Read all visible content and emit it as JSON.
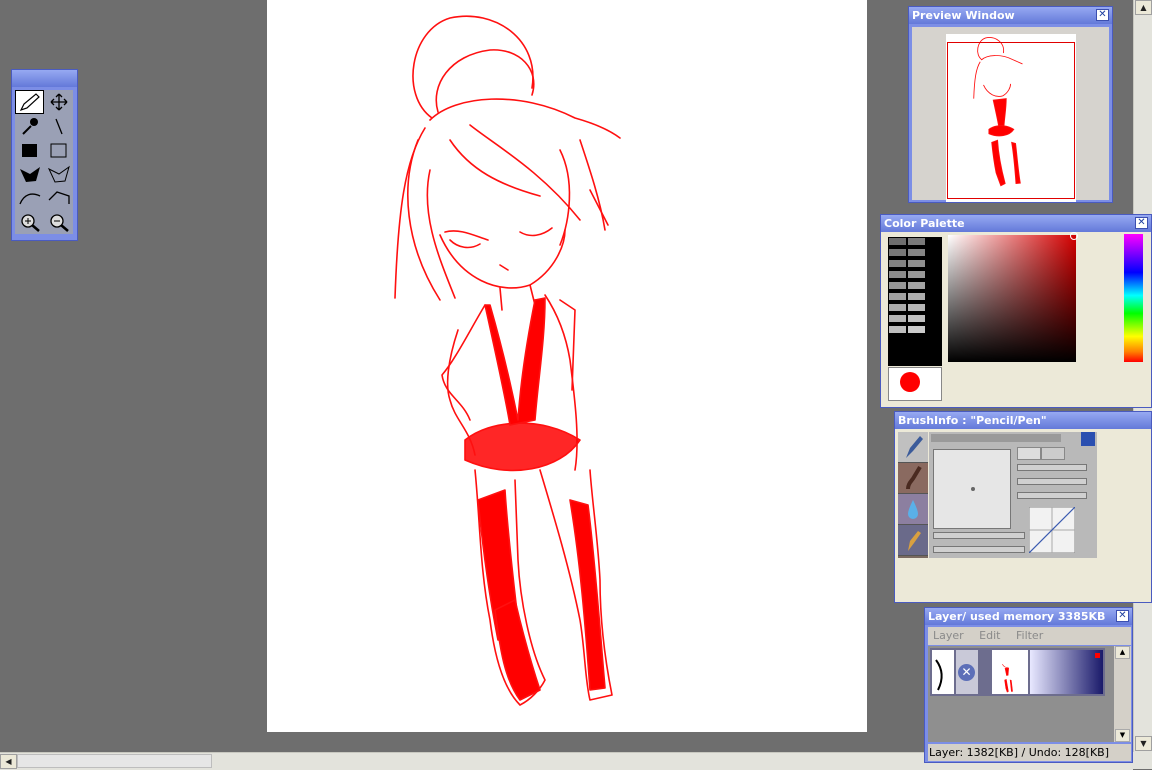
{
  "colors": {
    "workspace": "#6e6e6e",
    "accent_titlebar": "#7c8ee6",
    "stroke": "#ff0000",
    "current_color": "#ff0000"
  },
  "preview_window": {
    "title": "Preview Window",
    "close_icon": "close-icon"
  },
  "color_palette": {
    "title": "Color Palette",
    "close_icon": "close-icon"
  },
  "brush_info": {
    "title": "BrushInfo : \"Pencil/Pen\""
  },
  "layer_panel": {
    "title": "Layer/ used memory 3385KB",
    "menu": [
      "Layer",
      "Edit",
      "Filter"
    ],
    "status": "Layer: 1382[KB] / Undo: 128[KB]"
  },
  "tools": [
    {
      "name": "pencil-tool",
      "icon": "pencil-icon",
      "selected": true
    },
    {
      "name": "move-tool",
      "icon": "move-arrows-icon"
    },
    {
      "name": "eyedropper-tool",
      "icon": "eyedropper-icon"
    },
    {
      "name": "line-tool",
      "icon": "line-icon"
    },
    {
      "name": "fill-rect-tool",
      "icon": "filled-rect-icon"
    },
    {
      "name": "rect-select-tool",
      "icon": "rect-select-icon"
    },
    {
      "name": "fill-poly-tool",
      "icon": "filled-poly-icon"
    },
    {
      "name": "poly-select-tool",
      "icon": "poly-select-icon"
    },
    {
      "name": "curve-tool",
      "icon": "curve-icon"
    },
    {
      "name": "polyline-tool",
      "icon": "polyline-icon"
    },
    {
      "name": "zoom-in-tool",
      "icon": "zoom-in-icon"
    },
    {
      "name": "zoom-out-tool",
      "icon": "zoom-out-icon"
    }
  ]
}
